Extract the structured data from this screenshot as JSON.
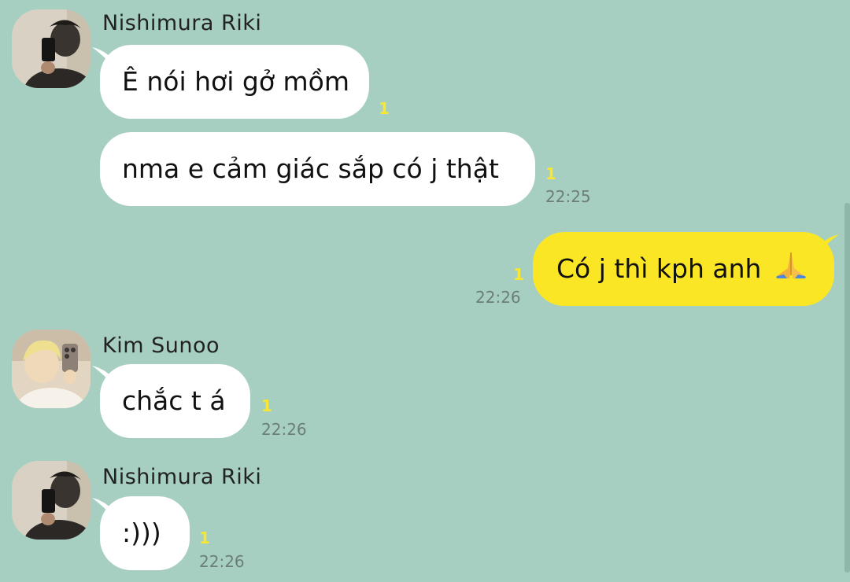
{
  "messages": [
    {
      "sender": "Nishimura Riki",
      "text": "Ê nói hơi gở mồm",
      "unread": "1",
      "time": ""
    },
    {
      "sender": "Nishimura Riki",
      "text": "nma e cảm giác sắp có j thật",
      "unread": "1",
      "time": "22:25"
    },
    {
      "sender": "me",
      "text": "Có j thì kph anh",
      "emoji": "folded-hands-icon",
      "unread": "1",
      "time": "22:26"
    },
    {
      "sender": "Kim Sunoo",
      "text": "chắc t á",
      "unread": "1",
      "time": "22:26"
    },
    {
      "sender": "Nishimura Riki",
      "text": ":)))",
      "unread": "1",
      "time": "22:26"
    }
  ],
  "colors": {
    "background": "#a6cfc1",
    "incoming_bubble": "#ffffff",
    "outgoing_bubble": "#fbe625",
    "unread_count": "#f7e634",
    "timestamp": "#6c7e77"
  }
}
